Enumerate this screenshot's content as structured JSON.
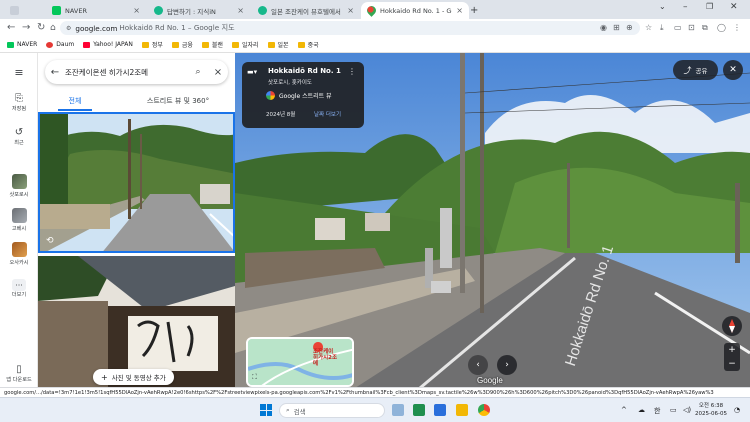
{
  "browser": {
    "tabs": [
      {
        "title": "NAVER",
        "color": "#03c75a",
        "active": false
      },
      {
        "title": "답변하기 : 지식iN",
        "color": "#16b88b",
        "active": false
      },
      {
        "title": "일본 조잔케이 뷰호텔에서 조",
        "color": "#16b88b",
        "active": false
      },
      {
        "title": "Hokkaido Rd No. 1 - Google",
        "color": "#ea4335",
        "active": true
      }
    ],
    "new_tab": "+",
    "url_domain": "google.com",
    "url_rest": "Hokkaidō Rd No. 1 – Google 지도",
    "bookmarks": [
      {
        "label": "NAVER",
        "color": "#03c75a",
        "folder": false
      },
      {
        "label": "Daum",
        "color": "#e53935",
        "folder": false
      },
      {
        "label": "Yahoo! JAPAN",
        "color": "#ff0033",
        "folder": false
      },
      {
        "label": "정부",
        "color": "#f2b705",
        "folder": true
      },
      {
        "label": "금융",
        "color": "#f2b705",
        "folder": true
      },
      {
        "label": "블랜",
        "color": "#f2b705",
        "folder": true
      },
      {
        "label": "일자리",
        "color": "#f2b705",
        "folder": true
      },
      {
        "label": "일본",
        "color": "#f2b705",
        "folder": true
      },
      {
        "label": "중국",
        "color": "#f2b705",
        "folder": true
      }
    ]
  },
  "rail": {
    "saved": "저장됨",
    "recent": "최근",
    "items": [
      "삿포로시",
      "고베시",
      "오사카시"
    ],
    "more": "더보기",
    "app_download": "앱 다운로드"
  },
  "panel": {
    "search_query": "조잔케이온센 히가시2조메",
    "tabs": [
      "전체",
      "스트리트 뷰 및 360°"
    ],
    "add_photo": "사진 및 동영상 추가"
  },
  "streetview": {
    "title": "Hokkaidō Rd No. 1",
    "subtitle": "삿포로시, 홋카이도",
    "credit": "Google 스트리트 뷰",
    "date": "2024년 8월",
    "see_more_dates": "날짜 더보기",
    "share": "공유",
    "road_label": "Hokkaidō Rd No. 1",
    "minimap_label": "조잔케이\n히가시2조\n메",
    "google": "Google"
  },
  "status_url": "google.com/.../data=!3m7!1e1!3m5!1sqfH55DlAoZjn-vAehRwpA!2e0!6shttps%2F%2Fstreetviewpixels-pa.googleapis.com%2Fv1%2Fthumbnail%3Fcb_client%3Dmaps_sv.tactile%26w%3D900%26h%3D600%26pitch%3D0%26panoid%3DqfH55DlAoZjn-vAehRwpA%26yaw%3",
  "taskbar": {
    "search": "검색",
    "lang": "한",
    "time": "오전 6:38",
    "date": "2025-06-05"
  }
}
